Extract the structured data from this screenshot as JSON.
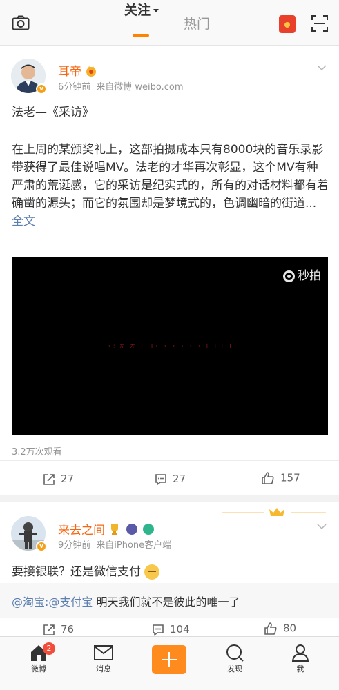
{
  "header": {
    "tab_follow": "关注",
    "tab_hot": "热门"
  },
  "colors": {
    "accent": "#ff8200",
    "username": "#f86510",
    "link": "#5d7fb0"
  },
  "posts": [
    {
      "username": "耳帝",
      "time": "6分钟前",
      "source": "来自微博 weibo.com",
      "title": "法老—《采访》",
      "body": "在上周的某颁奖礼上，这部拍摄成本只有8000块的音乐录影带获得了最佳说唱MV。法老的才华再次彰显，这个MV有种严肃的荒诞感，它的采访是纪实式的，所有的对话材料都有着确凿的源头；而它的氛围却是梦境式的，色调幽暗的街道...",
      "full_text_link": "全文",
      "video": {
        "watermark": "秒拍",
        "subtitle": "•：左 左 ：  [•   •   •    •  •  •  [ ] [ ]"
      },
      "views": "3.2万次观看",
      "reposts": "27",
      "comments": "27",
      "likes": "157"
    },
    {
      "username": "来去之间",
      "time": "9分钟前",
      "source": "来自iPhone客户端",
      "text": "要接银联？还是微信支付",
      "quote": {
        "link1": "@淘宝",
        "sep": ":",
        "link2": "@支付宝",
        "text": " 明天我们就不是彼此的唯一了"
      },
      "reposts": "76",
      "comments": "104",
      "likes": "80"
    }
  ],
  "bottom_nav": {
    "home": "微博",
    "home_badge": "2",
    "messages": "消息",
    "discover": "发现",
    "me": "我"
  }
}
